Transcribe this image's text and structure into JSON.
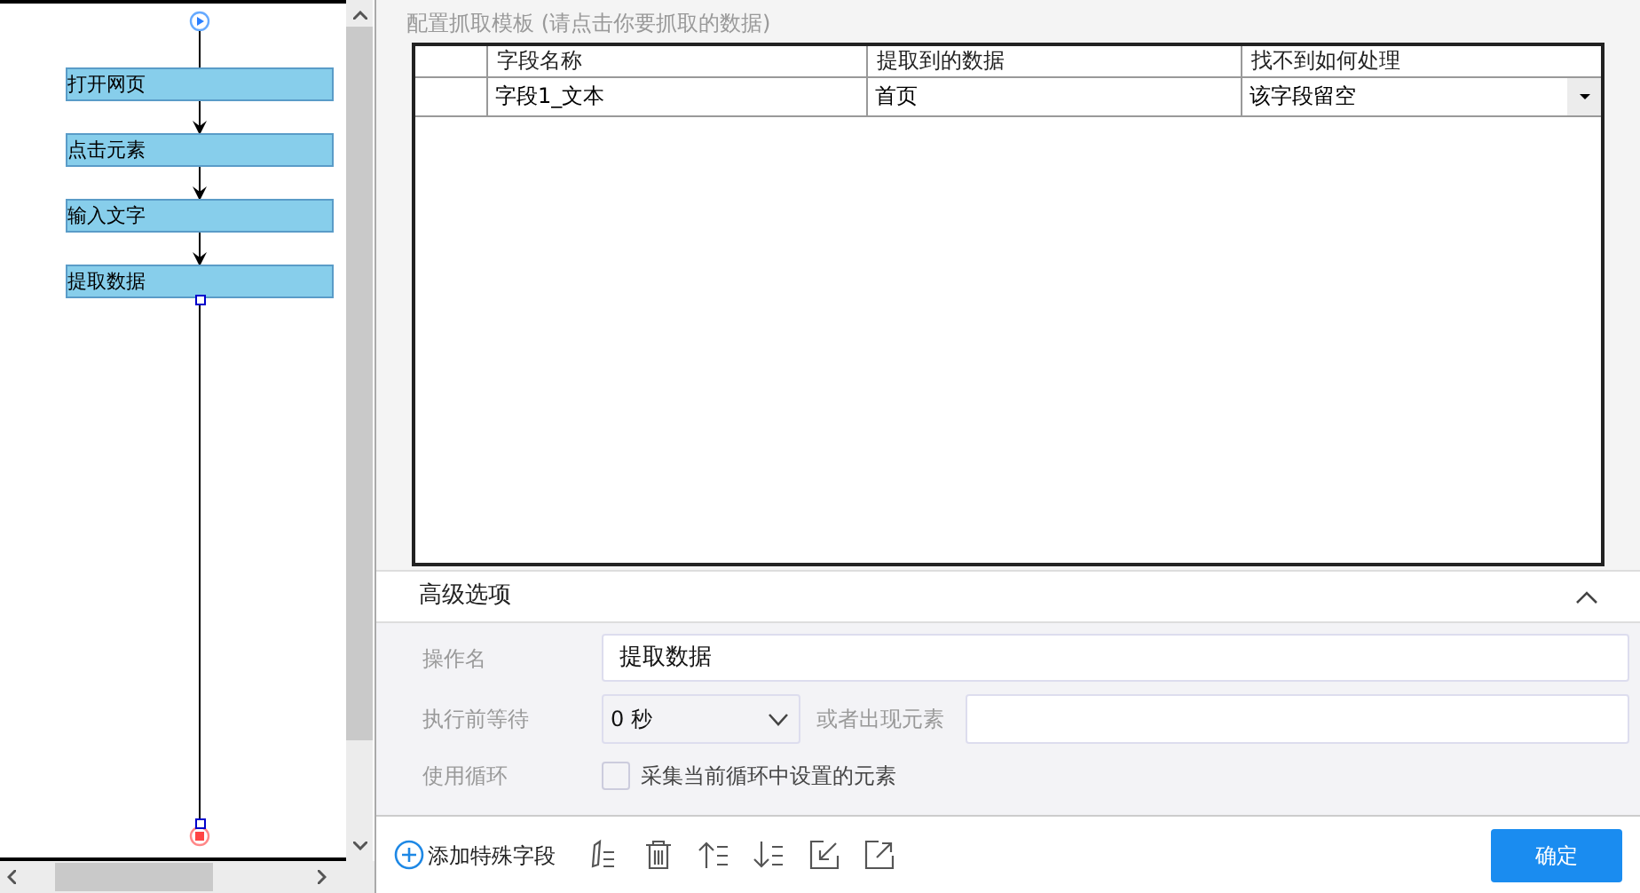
{
  "flow": {
    "nodes": [
      {
        "label": "打开网页",
        "selected": false
      },
      {
        "label": "点击元素",
        "selected": false
      },
      {
        "label": "输入文字",
        "selected": false
      },
      {
        "label": "提取数据",
        "selected": true
      }
    ]
  },
  "template": {
    "title": "配置抓取模板 (请点击你要抓取的数据)",
    "columns": [
      "字段名称",
      "提取到的数据",
      "找不到如何处理"
    ],
    "rows": [
      {
        "field": "字段1_文本",
        "data": "首页",
        "on_missing": "该字段留空"
      }
    ]
  },
  "advanced": {
    "title": "高级选项",
    "expanded": true,
    "name_label": "操作名",
    "name_value": "提取数据",
    "wait_label": "执行前等待",
    "wait_value": "0 秒",
    "or_label": "或者出现元素",
    "loop_label": "使用循环",
    "loop_option": "采集当前循环中设置的元素",
    "loop_checked": false
  },
  "toolbar": {
    "add_field": "添加特殊字段",
    "confirm": "确定"
  }
}
